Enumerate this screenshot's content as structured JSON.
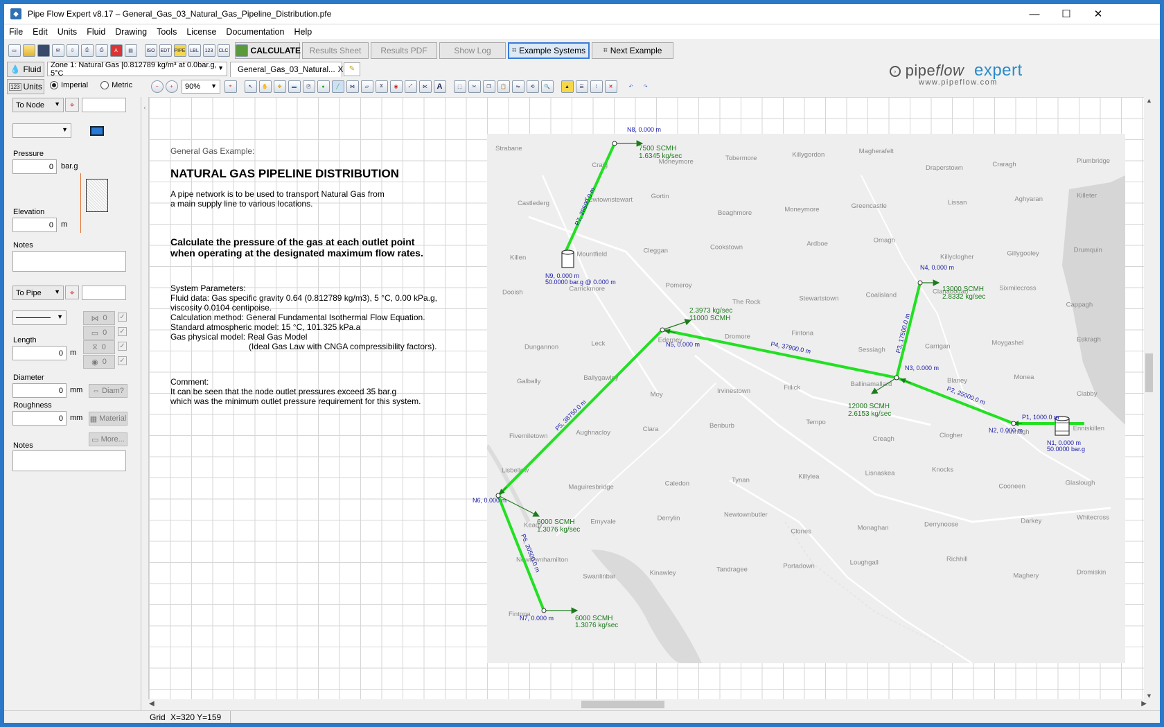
{
  "window": {
    "title": "Pipe Flow Expert v8.17 – General_Gas_03_Natural_Gas_Pipeline_Distribution.pfe",
    "min": "—",
    "max": "☐",
    "close": "✕"
  },
  "menu": [
    "File",
    "Edit",
    "Units",
    "Fluid",
    "Drawing",
    "Tools",
    "License",
    "Documentation",
    "Help"
  ],
  "toolbar": {
    "calculate": "CALCULATE",
    "results_sheet": "Results Sheet",
    "results_pdf": "Results PDF",
    "show_log": "Show Log",
    "example_systems": "Example Systems",
    "next_example": "Next Example"
  },
  "row2": {
    "fluid_button": "Fluid",
    "fluid_zone": "Zone 1: Natural Gas [0.812789 kg/m³ at 0.0bar.g, 5°C",
    "tab_label": "General_Gas_03_Natural...",
    "tab_close": "X"
  },
  "row3": {
    "units_button": "Units",
    "imperial": "Imperial",
    "metric": "Metric",
    "zoom": "90%"
  },
  "brand": {
    "name_a": "pipe",
    "name_b": "flow",
    "name_c": "expert",
    "url": "www.pipeflow.com"
  },
  "left": {
    "node_select": "To Node",
    "pressure_label": "Pressure",
    "pressure_value": "0",
    "pressure_unit": "bar.g",
    "elevation_label": "Elevation",
    "elevation_value": "0",
    "elevation_unit": "m",
    "notes_label": "Notes",
    "pipe_select": "To Pipe",
    "fit_values": [
      "0",
      "0",
      "0",
      "0"
    ],
    "length_label": "Length",
    "length_value": "0",
    "length_unit": "m",
    "diameter_label": "Diameter",
    "diameter_value": "0",
    "diameter_unit": "mm",
    "diam_button": "Diam?",
    "roughness_label": "Roughness",
    "roughness_value": "0",
    "roughness_unit": "mm",
    "material_button": "Material",
    "more_button": "More...",
    "notes2_label": "Notes"
  },
  "doc": {
    "heading_small": "General Gas Example:",
    "title": "NATURAL GAS PIPELINE DISTRIBUTION",
    "intro_1": "A pipe network is to be used to transport Natural Gas from",
    "intro_2": "a main supply line to various locations.",
    "task_1": "Calculate the pressure of the gas at each outlet point",
    "task_2": "when operating at the designated maximum flow rates.",
    "params_head": "System Parameters:",
    "p1": "Fluid data: Gas specific gravity 0.64 (0.812789 kg/m3), 5 °C, 0.00 kPa.g,",
    "p2": "viscosity 0.0104 centipoise.",
    "p3": "Calculation method: General Fundamental Isothermal Flow Equation.",
    "p4": "Standard atmospheric model: 15 °C, 101.325 kPa.a",
    "p5": "Gas physical model: Real Gas Model",
    "p6": "(Ideal Gas Law with CNGA compressibility factors).",
    "comment_head": "Comment:",
    "c1": "It can be seen that the node outlet pressures exceed 35 bar.g",
    "c2": "which was the minimum outlet pressure requirement for this system."
  },
  "network": {
    "nodes": [
      {
        "id": "n8",
        "label": "N8, 0.000 m"
      },
      {
        "id": "n9",
        "label": "N9, 0.000 m",
        "sub": "50.0000 bar.g @ 0.000 m"
      },
      {
        "id": "n4",
        "label": "N4, 0.000 m"
      },
      {
        "id": "n5",
        "label": "N5, 0.000 m"
      },
      {
        "id": "n3",
        "label": "N3, 0.000 m"
      },
      {
        "id": "n2",
        "label": "N2, 0.000 m"
      },
      {
        "id": "n1",
        "label": "N1, 0.000 m",
        "sub": "50.0000 bar.g"
      },
      {
        "id": "n6",
        "label": "N6, 0.000 m"
      },
      {
        "id": "n7",
        "label": "N7, 0.000 m"
      }
    ],
    "pipes": [
      {
        "id": "p1",
        "label": "P1, 1000.0 m"
      },
      {
        "id": "p2",
        "label": "P2, 25000.0 m"
      },
      {
        "id": "p3",
        "label": "P3, 17500.0 m"
      },
      {
        "id": "p4",
        "label": "P4, 37900.0 m"
      },
      {
        "id": "p5",
        "label": "P5, 38750.0 m"
      },
      {
        "id": "p6",
        "label": "P6, 20500.0 m"
      },
      {
        "id": "p7",
        "label": "P7, 28500.0 m"
      }
    ],
    "flows": [
      {
        "id": "f8",
        "a": "7500 SCMH",
        "b": "1.6345 kg/sec"
      },
      {
        "id": "f4",
        "a": "13000 SCMH",
        "b": "2.8332 kg/sec"
      },
      {
        "id": "f5",
        "a": "2.3973 kg/sec",
        "b": "11000 SCMH"
      },
      {
        "id": "f3",
        "a": "12000 SCMH",
        "b": "2.6153 kg/sec"
      },
      {
        "id": "f6",
        "a": "6000 SCMH",
        "b": "1.3076 kg/sec"
      },
      {
        "id": "f7",
        "a": "6000 SCMH",
        "b": "1.3076 kg/sec"
      }
    ],
    "places": [
      "Strabane",
      "Craig",
      "Moneymore",
      "Tobermore",
      "Killygordon",
      "Magherafelt",
      "Draperstown",
      "Craragh",
      "Plumbridge",
      "Castlederg",
      "Newtownstewart",
      "Gortin",
      "Beaghmore",
      "Moneymore",
      "Greencastle",
      "Lissan",
      "Aghyaran",
      "Killeter",
      "Killen",
      "Mountfield",
      "Cleggan",
      "Cookstown",
      "Ardboe",
      "Omagh",
      "Killyclogher",
      "Gillygooley",
      "Drumquin",
      "Dooish",
      "Carrickmore",
      "Pomeroy",
      "The Rock",
      "Stewartstown",
      "Coalisland",
      "Clanabogan",
      "Sixmilecross",
      "Cappagh",
      "Dungannon",
      "Leck",
      "Ederney",
      "Dromore",
      "Fintona",
      "Sessiagh",
      "Carrigan",
      "Moygashel",
      "Eskragh",
      "Galbally",
      "Ballygawley",
      "Moy",
      "Irvinestown",
      "Fillick",
      "Ballinamallard",
      "Blaney",
      "Monea",
      "Clabby",
      "Fivemiletown",
      "Aughnacloy",
      "Clara",
      "Benburb",
      "Tempo",
      "Creagh",
      "Clogher",
      "Armagh",
      "Enniskillen",
      "Lisbellow",
      "Maguiresbridge",
      "Caledon",
      "Tynan",
      "Killylea",
      "Lisnaskea",
      "Knocks",
      "Cooneen",
      "Glaslough",
      "Keady",
      "Emyvale",
      "Derrylin",
      "Newtownbutler",
      "Clones",
      "Monaghan",
      "Derrynoose",
      "Darkey",
      "Whitecross",
      "Newtownhamilton",
      "Swanlinbar",
      "Kinawley",
      "Tandragee",
      "Portadown",
      "Loughgall",
      "Richhill",
      "Maghery",
      "Dromiskin",
      "Fintona"
    ]
  },
  "status": {
    "grid": "Grid",
    "coords": "X=320  Y=159"
  },
  "colors": {
    "pipe": "#22e022",
    "flow": "#1e7a1e",
    "label": "#1a1aa8",
    "accent": "#3a7bd5"
  }
}
